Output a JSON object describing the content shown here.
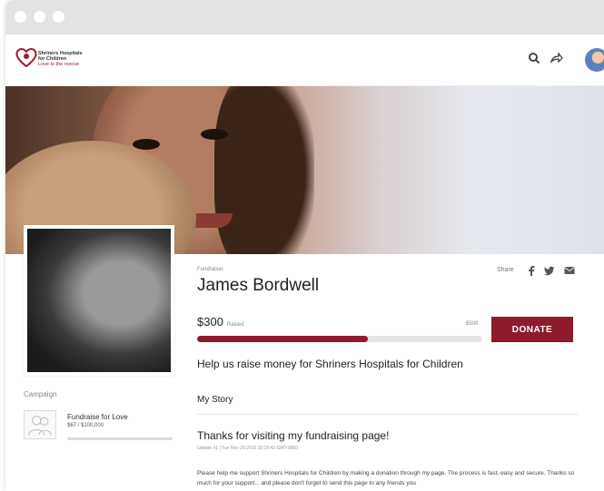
{
  "window": {
    "controls": [
      "close",
      "minimize",
      "maximize"
    ]
  },
  "navbar": {
    "logo": {
      "line1": "Shriners Hospitals",
      "line2": "for Children",
      "tagline": "Love to the rescue",
      "icon": "heart-logo-icon"
    },
    "icons": [
      "search-icon",
      "share-icon",
      "avatar"
    ]
  },
  "fundraiser": {
    "label": "Fundraiser",
    "name": "James Bordwell",
    "share_label": "Share",
    "share_icons": [
      "facebook-icon",
      "twitter-icon",
      "email-icon"
    ],
    "raised_amount": "$300",
    "raised_label": "Raised",
    "goal": "$500",
    "progress_fraction": 0.6,
    "donate_label": "DONATE",
    "tagline": "Help us raise money for Shriners Hospitals for Children"
  },
  "campaign": {
    "label": "Campaign",
    "name": "Fundraise for Love",
    "amount": "$67 / $100,000"
  },
  "story": {
    "heading": "My Story",
    "update_title": "Thanks for visiting my fundraising page!",
    "update_meta": "Update #1  |  Tue Nov 29 2016 10:10:43 GMT-0800",
    "body": "Please help me support Shriners Hospitals for Children by making a donation through my page. The process is fast, easy and secure. Thanks so much for your support... and please don't forget to send this page to any friends you"
  },
  "colors": {
    "brand": "#8e1a2b",
    "titlebar": "#e3e3e3"
  }
}
